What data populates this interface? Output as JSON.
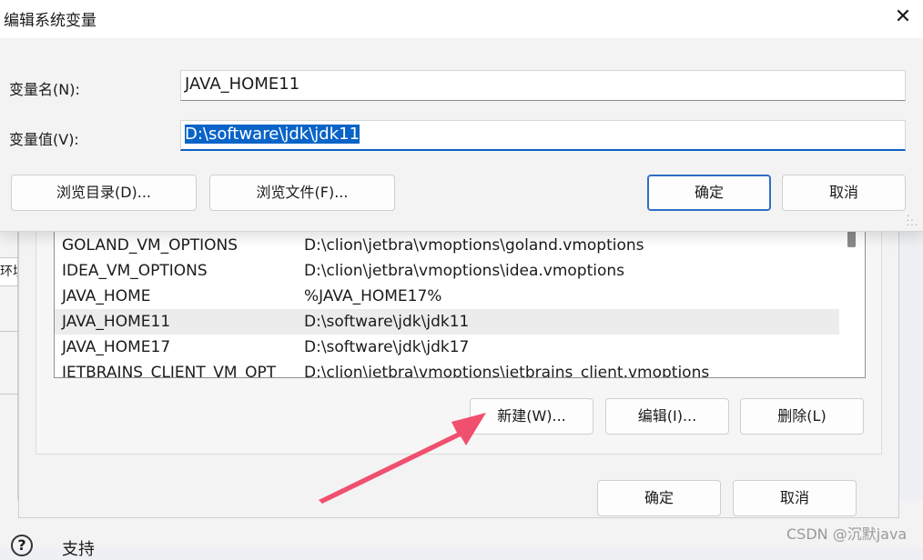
{
  "edit_dialog": {
    "title": "编辑系统变量",
    "name_label": "变量名(N):",
    "name_value": "JAVA_HOME11",
    "value_label": "变量值(V):",
    "value_value": "D:\\software\\jdk\\jdk11",
    "browse_dir_label": "浏览目录(D)...",
    "browse_file_label": "浏览文件(F)...",
    "ok_label": "确定",
    "cancel_label": "取消"
  },
  "background": {
    "left_input_text": "环境",
    "help_icon": "?",
    "help_text": "支持"
  },
  "system_variables": {
    "rows": [
      {
        "name": "GOLAND_VM_OPTIONS",
        "value": "D:\\clion\\jetbra\\vmoptions\\goland.vmoptions"
      },
      {
        "name": "IDEA_VM_OPTIONS",
        "value": "D:\\clion\\jetbra\\vmoptions\\idea.vmoptions"
      },
      {
        "name": "JAVA_HOME",
        "value": "%JAVA_HOME17%"
      },
      {
        "name": "JAVA_HOME11",
        "value": "D:\\software\\jdk\\jdk11"
      },
      {
        "name": "JAVA_HOME17",
        "value": "D:\\software\\jdk\\jdk17"
      },
      {
        "name": "JETBRAINS_CLIENT_VM_OPT",
        "value": "D:\\clion\\jetbra\\vmoptions\\jetbrains_client.vmoptions"
      }
    ],
    "selected_row": "JAVA_HOME11",
    "new_label": "新建(W)...",
    "edit_label": "编辑(I)...",
    "delete_label": "删除(L)",
    "ok_label": "确定",
    "cancel_label": "取消"
  },
  "watermark": "CSDN @沉默java",
  "colors": {
    "accent": "#0a64c8",
    "arrow": "#f0506e"
  }
}
